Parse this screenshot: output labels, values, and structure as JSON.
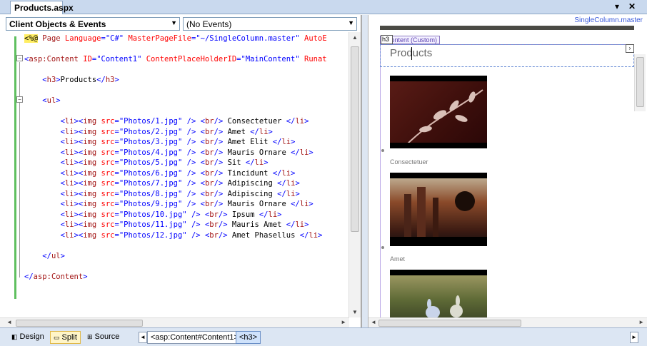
{
  "tab": {
    "title": "Products.aspx",
    "dropdown_glyph": "▾",
    "close_glyph": "✕"
  },
  "source": {
    "objects_dropdown": "Client Objects & Events",
    "events_dropdown": "(No Events)",
    "lines": [
      [
        [
          "dir",
          "<%@"
        ],
        [
          "text",
          " "
        ],
        [
          "tag",
          "Page"
        ],
        [
          "text",
          " "
        ],
        [
          "attr",
          "Language"
        ],
        [
          "bracket",
          "="
        ],
        [
          "val",
          "\"C#\""
        ],
        [
          "text",
          " "
        ],
        [
          "attr",
          "MasterPageFile"
        ],
        [
          "bracket",
          "="
        ],
        [
          "val",
          "\"~/SingleColumn.master\""
        ],
        [
          "text",
          " "
        ],
        [
          "attr",
          "AutoE"
        ]
      ],
      [],
      [
        [
          "bracket",
          "<"
        ],
        [
          "tag",
          "asp:Content"
        ],
        [
          "text",
          " "
        ],
        [
          "attr",
          "ID"
        ],
        [
          "bracket",
          "="
        ],
        [
          "val",
          "\"Content1\""
        ],
        [
          "text",
          " "
        ],
        [
          "attr",
          "ContentPlaceHolderID"
        ],
        [
          "bracket",
          "="
        ],
        [
          "val",
          "\"MainContent\""
        ],
        [
          "text",
          " "
        ],
        [
          "attr",
          "Runat"
        ]
      ],
      [],
      [
        [
          "text",
          "    "
        ],
        [
          "bracket",
          "<"
        ],
        [
          "tag",
          "h3"
        ],
        [
          "bracket",
          ">"
        ],
        [
          "text",
          "Products"
        ],
        [
          "bracket",
          "</"
        ],
        [
          "tag",
          "h3"
        ],
        [
          "bracket",
          ">"
        ]
      ],
      [],
      [
        [
          "text",
          "    "
        ],
        [
          "bracket",
          "<"
        ],
        [
          "tag",
          "ul"
        ],
        [
          "bracket",
          ">"
        ]
      ],
      [],
      [
        [
          "text",
          "        "
        ],
        [
          "bracket",
          "<"
        ],
        [
          "tag",
          "li"
        ],
        [
          "bracket",
          "><"
        ],
        [
          "tag",
          "img"
        ],
        [
          "text",
          " "
        ],
        [
          "attr",
          "src"
        ],
        [
          "bracket",
          "="
        ],
        [
          "val",
          "\"Photos/1.jpg\""
        ],
        [
          "text",
          " "
        ],
        [
          "bracket",
          "/>"
        ],
        [
          "text",
          " "
        ],
        [
          "bracket",
          "<"
        ],
        [
          "tag",
          "br"
        ],
        [
          "bracket",
          "/>"
        ],
        [
          "text",
          " Consectetuer "
        ],
        [
          "bracket",
          "</"
        ],
        [
          "tag",
          "li"
        ],
        [
          "bracket",
          ">"
        ]
      ],
      [
        [
          "text",
          "        "
        ],
        [
          "bracket",
          "<"
        ],
        [
          "tag",
          "li"
        ],
        [
          "bracket",
          "><"
        ],
        [
          "tag",
          "img"
        ],
        [
          "text",
          " "
        ],
        [
          "attr",
          "src"
        ],
        [
          "bracket",
          "="
        ],
        [
          "val",
          "\"Photos/2.jpg\""
        ],
        [
          "text",
          " "
        ],
        [
          "bracket",
          "/>"
        ],
        [
          "text",
          " "
        ],
        [
          "bracket",
          "<"
        ],
        [
          "tag",
          "br"
        ],
        [
          "bracket",
          "/>"
        ],
        [
          "text",
          " Amet "
        ],
        [
          "bracket",
          "</"
        ],
        [
          "tag",
          "li"
        ],
        [
          "bracket",
          ">"
        ]
      ],
      [
        [
          "text",
          "        "
        ],
        [
          "bracket",
          "<"
        ],
        [
          "tag",
          "li"
        ],
        [
          "bracket",
          "><"
        ],
        [
          "tag",
          "img"
        ],
        [
          "text",
          " "
        ],
        [
          "attr",
          "src"
        ],
        [
          "bracket",
          "="
        ],
        [
          "val",
          "\"Photos/3.jpg\""
        ],
        [
          "text",
          " "
        ],
        [
          "bracket",
          "/>"
        ],
        [
          "text",
          " "
        ],
        [
          "bracket",
          "<"
        ],
        [
          "tag",
          "br"
        ],
        [
          "bracket",
          "/>"
        ],
        [
          "text",
          " Amet Elit "
        ],
        [
          "bracket",
          "</"
        ],
        [
          "tag",
          "li"
        ],
        [
          "bracket",
          ">"
        ]
      ],
      [
        [
          "text",
          "        "
        ],
        [
          "bracket",
          "<"
        ],
        [
          "tag",
          "li"
        ],
        [
          "bracket",
          "><"
        ],
        [
          "tag",
          "img"
        ],
        [
          "text",
          " "
        ],
        [
          "attr",
          "src"
        ],
        [
          "bracket",
          "="
        ],
        [
          "val",
          "\"Photos/4.jpg\""
        ],
        [
          "text",
          " "
        ],
        [
          "bracket",
          "/>"
        ],
        [
          "text",
          " "
        ],
        [
          "bracket",
          "<"
        ],
        [
          "tag",
          "br"
        ],
        [
          "bracket",
          "/>"
        ],
        [
          "text",
          " Mauris Ornare "
        ],
        [
          "bracket",
          "</"
        ],
        [
          "tag",
          "li"
        ],
        [
          "bracket",
          ">"
        ]
      ],
      [
        [
          "text",
          "        "
        ],
        [
          "bracket",
          "<"
        ],
        [
          "tag",
          "li"
        ],
        [
          "bracket",
          "><"
        ],
        [
          "tag",
          "img"
        ],
        [
          "text",
          " "
        ],
        [
          "attr",
          "src"
        ],
        [
          "bracket",
          "="
        ],
        [
          "val",
          "\"Photos/5.jpg\""
        ],
        [
          "text",
          " "
        ],
        [
          "bracket",
          "/>"
        ],
        [
          "text",
          " "
        ],
        [
          "bracket",
          "<"
        ],
        [
          "tag",
          "br"
        ],
        [
          "bracket",
          "/>"
        ],
        [
          "text",
          " Sit "
        ],
        [
          "bracket",
          "</"
        ],
        [
          "tag",
          "li"
        ],
        [
          "bracket",
          ">"
        ]
      ],
      [
        [
          "text",
          "        "
        ],
        [
          "bracket",
          "<"
        ],
        [
          "tag",
          "li"
        ],
        [
          "bracket",
          "><"
        ],
        [
          "tag",
          "img"
        ],
        [
          "text",
          " "
        ],
        [
          "attr",
          "src"
        ],
        [
          "bracket",
          "="
        ],
        [
          "val",
          "\"Photos/6.jpg\""
        ],
        [
          "text",
          " "
        ],
        [
          "bracket",
          "/>"
        ],
        [
          "text",
          " "
        ],
        [
          "bracket",
          "<"
        ],
        [
          "tag",
          "br"
        ],
        [
          "bracket",
          "/>"
        ],
        [
          "text",
          " Tincidunt "
        ],
        [
          "bracket",
          "</"
        ],
        [
          "tag",
          "li"
        ],
        [
          "bracket",
          ">"
        ]
      ],
      [
        [
          "text",
          "        "
        ],
        [
          "bracket",
          "<"
        ],
        [
          "tag",
          "li"
        ],
        [
          "bracket",
          "><"
        ],
        [
          "tag",
          "img"
        ],
        [
          "text",
          " "
        ],
        [
          "attr",
          "src"
        ],
        [
          "bracket",
          "="
        ],
        [
          "val",
          "\"Photos/7.jpg\""
        ],
        [
          "text",
          " "
        ],
        [
          "bracket",
          "/>"
        ],
        [
          "text",
          " "
        ],
        [
          "bracket",
          "<"
        ],
        [
          "tag",
          "br"
        ],
        [
          "bracket",
          "/>"
        ],
        [
          "text",
          " Adipiscing "
        ],
        [
          "bracket",
          "</"
        ],
        [
          "tag",
          "li"
        ],
        [
          "bracket",
          ">"
        ]
      ],
      [
        [
          "text",
          "        "
        ],
        [
          "bracket",
          "<"
        ],
        [
          "tag",
          "li"
        ],
        [
          "bracket",
          "><"
        ],
        [
          "tag",
          "img"
        ],
        [
          "text",
          " "
        ],
        [
          "attr",
          "src"
        ],
        [
          "bracket",
          "="
        ],
        [
          "val",
          "\"Photos/8.jpg\""
        ],
        [
          "text",
          " "
        ],
        [
          "bracket",
          "/>"
        ],
        [
          "text",
          " "
        ],
        [
          "bracket",
          "<"
        ],
        [
          "tag",
          "br"
        ],
        [
          "bracket",
          "/>"
        ],
        [
          "text",
          " Adipiscing "
        ],
        [
          "bracket",
          "</"
        ],
        [
          "tag",
          "li"
        ],
        [
          "bracket",
          ">"
        ]
      ],
      [
        [
          "text",
          "        "
        ],
        [
          "bracket",
          "<"
        ],
        [
          "tag",
          "li"
        ],
        [
          "bracket",
          "><"
        ],
        [
          "tag",
          "img"
        ],
        [
          "text",
          " "
        ],
        [
          "attr",
          "src"
        ],
        [
          "bracket",
          "="
        ],
        [
          "val",
          "\"Photos/9.jpg\""
        ],
        [
          "text",
          " "
        ],
        [
          "bracket",
          "/>"
        ],
        [
          "text",
          " "
        ],
        [
          "bracket",
          "<"
        ],
        [
          "tag",
          "br"
        ],
        [
          "bracket",
          "/>"
        ],
        [
          "text",
          " Mauris Ornare "
        ],
        [
          "bracket",
          "</"
        ],
        [
          "tag",
          "li"
        ],
        [
          "bracket",
          ">"
        ]
      ],
      [
        [
          "text",
          "        "
        ],
        [
          "bracket",
          "<"
        ],
        [
          "tag",
          "li"
        ],
        [
          "bracket",
          "><"
        ],
        [
          "tag",
          "img"
        ],
        [
          "text",
          " "
        ],
        [
          "attr",
          "src"
        ],
        [
          "bracket",
          "="
        ],
        [
          "val",
          "\"Photos/10.jpg\""
        ],
        [
          "text",
          " "
        ],
        [
          "bracket",
          "/>"
        ],
        [
          "text",
          " "
        ],
        [
          "bracket",
          "<"
        ],
        [
          "tag",
          "br"
        ],
        [
          "bracket",
          "/>"
        ],
        [
          "text",
          " Ipsum "
        ],
        [
          "bracket",
          "</"
        ],
        [
          "tag",
          "li"
        ],
        [
          "bracket",
          ">"
        ]
      ],
      [
        [
          "text",
          "        "
        ],
        [
          "bracket",
          "<"
        ],
        [
          "tag",
          "li"
        ],
        [
          "bracket",
          "><"
        ],
        [
          "tag",
          "img"
        ],
        [
          "text",
          " "
        ],
        [
          "attr",
          "src"
        ],
        [
          "bracket",
          "="
        ],
        [
          "val",
          "\"Photos/11.jpg\""
        ],
        [
          "text",
          " "
        ],
        [
          "bracket",
          "/>"
        ],
        [
          "text",
          " "
        ],
        [
          "bracket",
          "<"
        ],
        [
          "tag",
          "br"
        ],
        [
          "bracket",
          "/>"
        ],
        [
          "text",
          " Mauris Amet "
        ],
        [
          "bracket",
          "</"
        ],
        [
          "tag",
          "li"
        ],
        [
          "bracket",
          ">"
        ]
      ],
      [
        [
          "text",
          "        "
        ],
        [
          "bracket",
          "<"
        ],
        [
          "tag",
          "li"
        ],
        [
          "bracket",
          "><"
        ],
        [
          "tag",
          "img"
        ],
        [
          "text",
          " "
        ],
        [
          "attr",
          "src"
        ],
        [
          "bracket",
          "="
        ],
        [
          "val",
          "\"Photos/12.jpg\""
        ],
        [
          "text",
          " "
        ],
        [
          "bracket",
          "/>"
        ],
        [
          "text",
          " "
        ],
        [
          "bracket",
          "<"
        ],
        [
          "tag",
          "br"
        ],
        [
          "bracket",
          "/>"
        ],
        [
          "text",
          " Amet Phasellus "
        ],
        [
          "bracket",
          "</"
        ],
        [
          "tag",
          "li"
        ],
        [
          "bracket",
          ">"
        ]
      ],
      [],
      [
        [
          "text",
          "    "
        ],
        [
          "bracket",
          "</"
        ],
        [
          "tag",
          "ul"
        ],
        [
          "bracket",
          ">"
        ]
      ],
      [],
      [
        [
          "bracket",
          "</"
        ],
        [
          "tag",
          "asp:Content"
        ],
        [
          "bracket",
          ">"
        ]
      ]
    ]
  },
  "design": {
    "master_label": "SingleColumn.master",
    "content_tag": "nContent (Custom)",
    "h3_tag": "h3",
    "heading": "Products",
    "captions": [
      "Consectetuer",
      "Amet"
    ]
  },
  "bottom": {
    "design_label": "Design",
    "split_label": "Split",
    "source_label": "Source",
    "crumbs": [
      "<asp:Content#Content1>",
      "<h3>"
    ]
  },
  "colors": {
    "tag": "#a31515",
    "attr": "#ff0000",
    "value": "#0000ff",
    "directive_highlight": "#ffee62",
    "change_bar": "#5fbf5f",
    "master_label": "#3b5bdb"
  }
}
